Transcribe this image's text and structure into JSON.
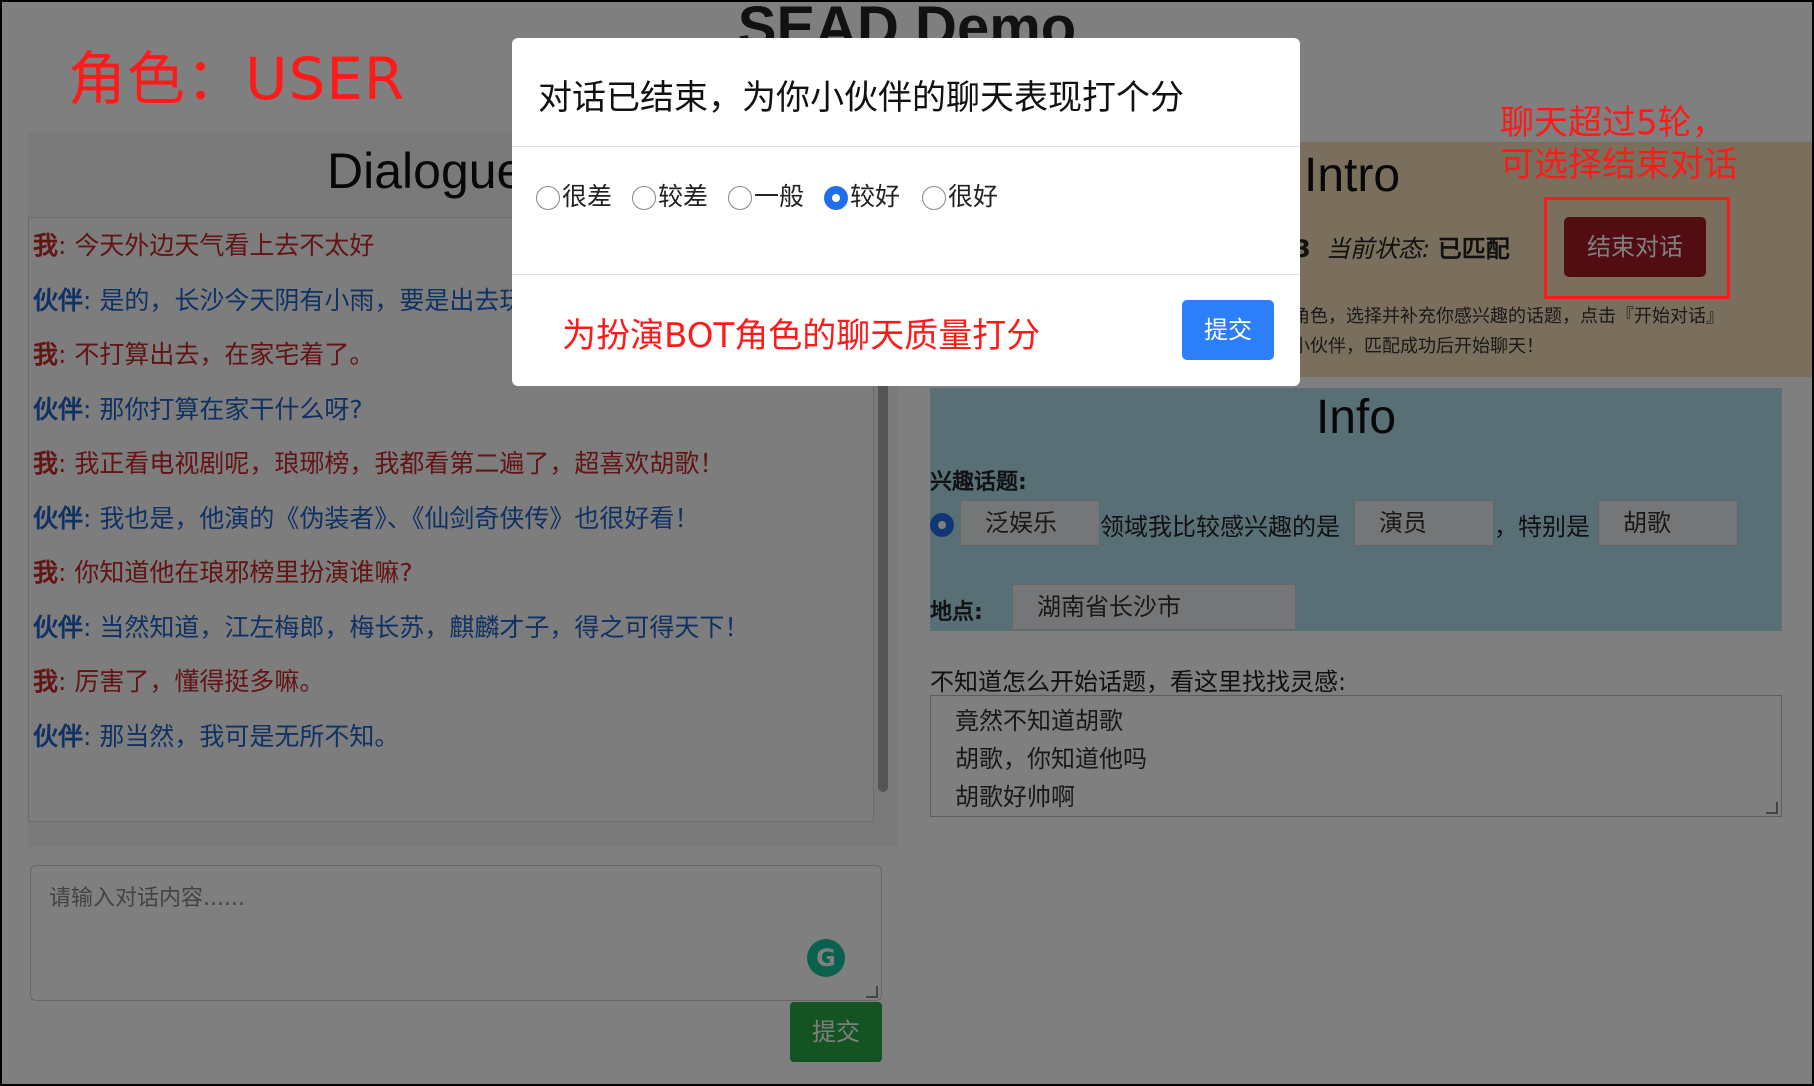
{
  "page": {
    "title": "SEAD Demo"
  },
  "role_annotation": "角色：USER",
  "dialogue": {
    "heading": "Dialogue",
    "messages": [
      {
        "speaker": "我",
        "text": ": 今天外边天气看上去不太好"
      },
      {
        "speaker": "伙伴",
        "text": ": 是的，长沙今天阴有小雨，要是出去玩"
      },
      {
        "speaker": "我",
        "text": ": 不打算出去，在家宅着了。"
      },
      {
        "speaker": "伙伴",
        "text": ": 那你打算在家干什么呀?"
      },
      {
        "speaker": "我",
        "text": ": 我正看电视剧呢，琅琊榜，我都看第二遍了，超喜欢胡歌！"
      },
      {
        "speaker": "伙伴",
        "text": ": 我也是，他演的《伪装者》、《仙剑奇侠传》也很好看！"
      },
      {
        "speaker": "我",
        "text": ": 你知道他在琅邪榜里扮演谁嘛?"
      },
      {
        "speaker": "伙伴",
        "text": ": 当然知道，江左梅郎，梅长苏，麒麟才子，得之可得天下！"
      },
      {
        "speaker": "我",
        "text": ": 厉害了，懂得挺多嘛。"
      },
      {
        "speaker": "伙伴",
        "text": ": 那当然，我可是无所不知。"
      }
    ],
    "input_placeholder": "请输入对话内容......",
    "grammarly_glyph": "G",
    "send_label": "提交"
  },
  "intro": {
    "heading": "Intro",
    "turn_count_fragment": "3",
    "status_label": "当前状态:",
    "status_value": "已匹配",
    "end_button_label": "结束对话",
    "text_line1": "角色，选择并补充你感兴趣的话题，点击『开始对话』",
    "text_line2": "小伙伴，匹配成功后开始聊天！"
  },
  "info": {
    "heading": "Info",
    "topic_label": "兴趣话题:",
    "topic_field": "泛娱乐",
    "topic_mid_text": "领域我比较感兴趣的是",
    "topic_value": "演员",
    "topic_special_text": "，特别是",
    "topic_special_value": "胡歌",
    "location_label": "地点:",
    "location_value": "湖南省长沙市",
    "hint_label": "不知道怎么开始话题，看这里找找灵感:",
    "hints": [
      "竟然不知道胡歌",
      "胡歌，你知道他吗",
      "胡歌好帅啊"
    ]
  },
  "annotation_right": {
    "line1": "聊天超过5轮，",
    "line2": "可选择结束对话"
  },
  "modal": {
    "title": "对话已结束，为你小伙伴的聊天表现打个分",
    "options": [
      "很差",
      "较差",
      "一般",
      "较好",
      "很好"
    ],
    "selected_option": "较好",
    "annotation": "为扮演BOT角色的聊天质量打分",
    "submit_label": "提交"
  },
  "colors": {
    "me": "#c62828",
    "partner": "#1e63c8",
    "annotation_red": "#ff1a1a",
    "primary_blue": "#2d7ff9",
    "end_button": "#a51b26",
    "send_green": "#28a745",
    "intro_bg": "#f5dfba",
    "info_bg": "#b2deec"
  }
}
